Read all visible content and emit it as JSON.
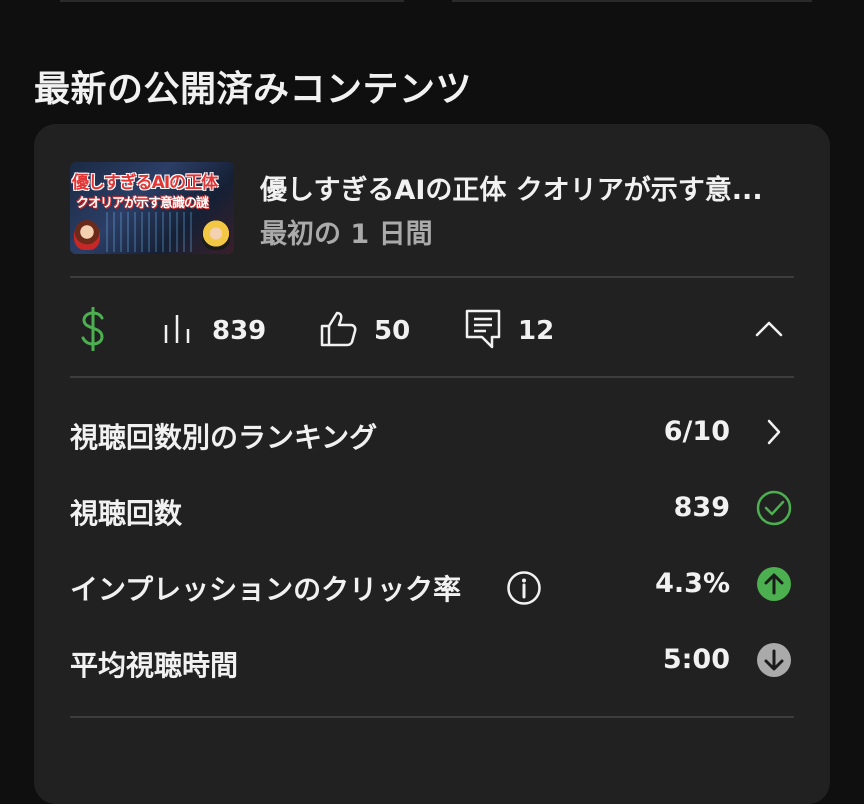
{
  "section": {
    "title": "最新の公開済みコンテンツ"
  },
  "video": {
    "title": "優しすぎるAIの正体 クオリアが示す意...",
    "period": "最初の 1 日間",
    "thumbnail_text_line1": "優しすぎるAIの正体",
    "thumbnail_text_line2": "クオリアが示す意識の謎"
  },
  "quick_stats": {
    "revenue_icon": "dollar-icon",
    "views_icon": "bar-chart-icon",
    "views": "839",
    "likes_icon": "thumbs-up-icon",
    "likes": "50",
    "comments_icon": "comment-icon",
    "comments": "12",
    "collapse_icon": "chevron-up-icon"
  },
  "metrics": [
    {
      "label": "視聴回数別のランキング",
      "value": "6/10",
      "trail_icon": "chevron-right-icon"
    },
    {
      "label": "視聴回数",
      "value": "839",
      "trail_icon": "check-circle-icon"
    },
    {
      "label": "インプレッションのクリック率",
      "value": "4.3%",
      "trail_icon": "arrow-up-circle-icon",
      "has_info": true
    },
    {
      "label": "平均視聴時間",
      "value": "5:00",
      "trail_icon": "arrow-down-circle-icon"
    }
  ],
  "colors": {
    "background": "#0f0f0f",
    "card": "#212121",
    "accent_green": "#4caf50",
    "neutral_gray": "#aaaaaa"
  }
}
